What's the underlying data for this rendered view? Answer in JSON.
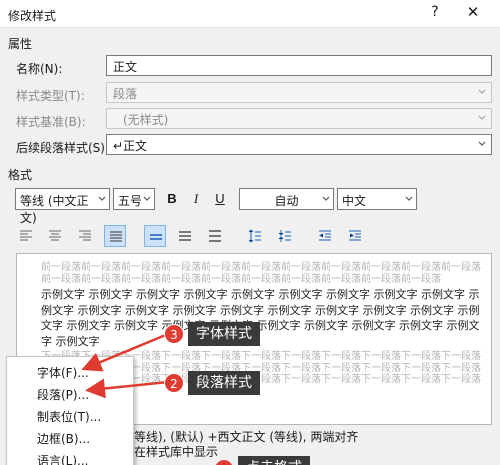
{
  "window": {
    "title": "修改样式",
    "help_glyph": "?",
    "close_glyph": "✕"
  },
  "properties": {
    "section_label": "属性",
    "name_label": "名称(N):",
    "name_value": "正文",
    "type_label": "样式类型(T):",
    "type_value": "段落",
    "based_on_label": "样式基准(B):",
    "based_on_value": "(无样式)",
    "next_label": "后续段落样式(S):",
    "next_value": "↵正文"
  },
  "format": {
    "section_label": "格式",
    "font": "等线 (中文正文)",
    "size": "五号",
    "bold": "B",
    "italic": "I",
    "underline": "U",
    "color": "自动",
    "script": "中文"
  },
  "preview": {
    "prev_text": "前一段落前一段落前一段落前一段落前一段落前一段落前一段落前一段落前一段落前一段落前一段落前一段落前一段落前一段落前一段落前一段落前一段落前一段落前一段落前一段落前一段落",
    "sample_text": "示例文字 示例文字 示例文字 示例文字 示例文字 示例文字 示例文字 示例文字 示例文字 示例文字 示例文字 示例文字 示例文字 示例文字 示例文字 示例文字 示例文字 示例文字 示例文字 示例文字 示例文字 示例文字 示例文字 示例文字 示例文字 示例文字 示例文字 示例文字 示例文字",
    "next_text": "下一段落下一段落下一段落下一段落下一段落下一段落下一段落下一段落下一段落下一段落下一段落下一段落下一段落下一段落下一段落下一段落下一段落下一段落下一段落下一段落下一段落下一段落下一段落下一段落下一段落下一段落下一段落下一段落下一段落下一段落下一段落下一段落下一段落下一段落"
  },
  "description": {
    "line1": "等线), (默认) +西文正文 (等线), 两端对齐",
    "line2": "在样式库中显示"
  },
  "context_menu": {
    "items": [
      "字体(F)...",
      "段落(P)...",
      "制表位(T)...",
      "边框(B)...",
      "语言(L)..."
    ]
  },
  "annotations": {
    "callout_font": "字体样式",
    "callout_font_badge": "3",
    "callout_para": "段落样式",
    "callout_para_badge": "2",
    "callout_bottom": "点击格式"
  },
  "colors": {
    "accent_red": "#e03b30",
    "callout_bg": "#3a3a3a",
    "active_button": "#cce1f7"
  }
}
